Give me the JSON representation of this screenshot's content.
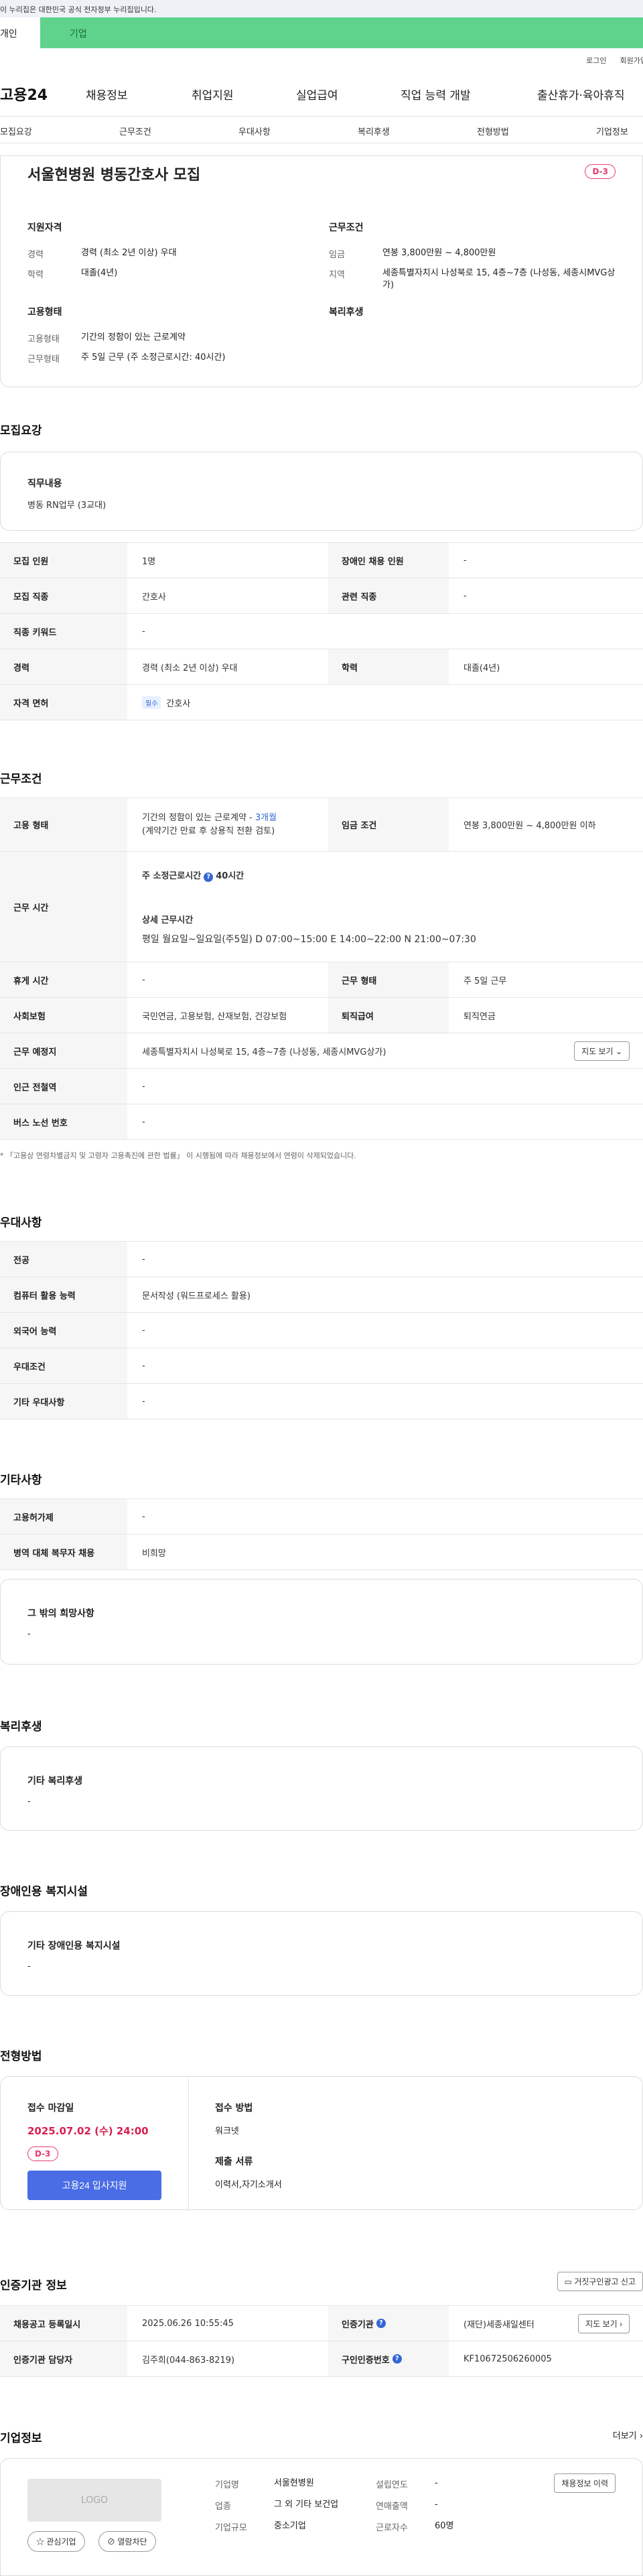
{
  "gov_banner": "이 누리집은 대한민국 공식 전자정부 누리집입니다.",
  "user_tabs": [
    "개인",
    "기업"
  ],
  "util": [
    "로그인",
    "회원가입"
  ],
  "logo": "고용24",
  "gnb": [
    "채용정보",
    "취업지원",
    "실업급여",
    "직업 능력 개발",
    "출산휴가·육아휴직"
  ],
  "anchor_nav": [
    "모집요강",
    "근무조건",
    "우대사항",
    "복리후생",
    "전형방법",
    "기업정보"
  ],
  "summary": {
    "title": "서울현병원 병동간호사 모집",
    "dday": "D-3",
    "qual_head": "지원자격",
    "career_label": "경력",
    "career_value": "경력 (최소 2년 이상) 우대",
    "edu_label": "학력",
    "edu_value": "대졸(4년)",
    "emp_head": "고용형태",
    "emptype_label": "고용형태",
    "emptype_value": "기간의 정함이 있는 근로계약",
    "worktype_label": "근무형태",
    "worktype_value": "주 5일 근무 (주 소정근로시간: 40시간)",
    "cond_head": "근무조건",
    "wage_label": "임금",
    "wage_value": "연봉 3,800만원 ~ 4,800만원",
    "area_label": "지역",
    "area_value": "세종특별자치시 나성북로 15, 4층~7층 (나성동, 세종시MVG상가)",
    "welfare_head": "복리후생"
  },
  "recruit": {
    "section_title": "모집요강",
    "duty_title": "직무내용",
    "duty_value": "병동 RN업무 (3교대)",
    "rows": {
      "headcount_label": "모집 인원",
      "headcount_value": "1명",
      "disabled_label": "장애인 채용 인원",
      "disabled_value": "-",
      "job_label": "모집 직종",
      "job_value": "간호사",
      "related_label": "관련 직종",
      "related_value": "-",
      "keyword_label": "직종 키워드",
      "keyword_value": "-",
      "career_label": "경력",
      "career_value": "경력 (최소 2년 이상) 우대",
      "edu_label": "학력",
      "edu_value": "대졸(4년)",
      "license_label": "자격 면허",
      "license_tag": "필수",
      "license_value": "간호사"
    }
  },
  "work": {
    "section_title": "근무조건",
    "emptype_label": "고용 형태",
    "emptype_value": "기간의 정함이 있는 근로계약 - ",
    "emptype_period": "3개월",
    "emptype_note": "(계약기간 만료 후 상용직 전환 검토)",
    "wage_label": "임금 조건",
    "wage_value": "연봉 3,800만원 ~ 4,800만원 이하",
    "hours_label": "근무 시간",
    "hours_week": "주 소정근로시간",
    "hours_week_value": "40시간",
    "hours_detail_title": "상세 근무시간",
    "hours_detail": "평일 월요일~일요일(주5일) D 07:00~15:00 E 14:00~22:00 N 21:00~07:30",
    "rest_label": "휴게 시간",
    "rest_value": "-",
    "worktype_label": "근무 형태",
    "worktype_value": "주 5일 근무",
    "insurance_label": "사회보험",
    "insurance_value": "국민연금, 고용보험, 산재보험, 건강보험",
    "retire_label": "퇴직급여",
    "retire_value": "퇴직연금",
    "place_label": "근무 예정지",
    "place_value": "세종특별자치시 나성북로 15, 4층~7층 (나성동, 세종시MVG상가)",
    "map_button": "지도 보기",
    "subway_label": "인근 전철역",
    "subway_value": "-",
    "bus_label": "버스 노선 번호",
    "bus_value": "-",
    "note": "* 「고용상 연령차별금지 및 고령자 고용촉진에 관한 법률」 이 시행됨에 따라 채용정보에서 연령이 삭제되었습니다."
  },
  "pref": {
    "section_title": "우대사항",
    "major_label": "전공",
    "major_value": "-",
    "pc_label": "컴퓨터 활용 능력",
    "pc_value": "문서작성 (워드프로세스 활용)",
    "lang_label": "외국어 능력",
    "lang_value": "-",
    "cond_label": "우대조건",
    "cond_value": "-",
    "etc_label": "기타 우대사항",
    "etc_value": "-"
  },
  "other": {
    "section_title": "기타사항",
    "permit_label": "고용허가제",
    "permit_value": "-",
    "military_label": "병역 대체 복무자 채용",
    "military_value": "비희망",
    "wish_title": "그 밖의 희망사항",
    "wish_value": "-"
  },
  "welfare": {
    "section_title": "복리후생",
    "box_title": "기타 복리후생",
    "box_value": "-"
  },
  "disabled": {
    "section_title": "장애인용 복지시설",
    "box_title": "기타 장애인용 복지시설",
    "box_value": "-"
  },
  "process": {
    "section_title": "전형방법",
    "deadline_title": "접수 마감일",
    "deadline_value": "2025.07.02 (수) 24:00",
    "dday": "D-3",
    "apply_button": "고용24 입사지원",
    "method_title": "접수 방법",
    "method_value": "워크넷",
    "docs_title": "제출 서류",
    "docs_value": "이력서,자기소개서"
  },
  "cert": {
    "section_title": "인증기관 정보",
    "report_button": "거짓구인광고 신고",
    "posted_label": "채용공고 등록일시",
    "posted_value": "2025.06.26 10:55:45",
    "agency_label": "인증기관",
    "agency_value": "(재단)세종새일센터",
    "map_button": "지도 보기",
    "manager_label": "인증기관 담당자",
    "manager_value": "김주희(044-863-8219)",
    "certno_label": "구인인증번호",
    "certno_value": "KF10672506260005"
  },
  "company": {
    "section_title": "기업정보",
    "more_link": "더보기",
    "logo_text": "LOGO",
    "interest_button": "관심기업",
    "block_button": "열람차단",
    "name_label": "기업명",
    "name_value": "서울현병원",
    "year_label": "설립연도",
    "year_value": "-",
    "industry_label": "업종",
    "industry_value": "그 외 기타 보건업",
    "sales_label": "연매출액",
    "sales_value": "-",
    "size_label": "기업규모",
    "size_value": "중소기업",
    "staff_label": "근로자수",
    "staff_value": "60명",
    "history_button": "채용정보 이력"
  }
}
